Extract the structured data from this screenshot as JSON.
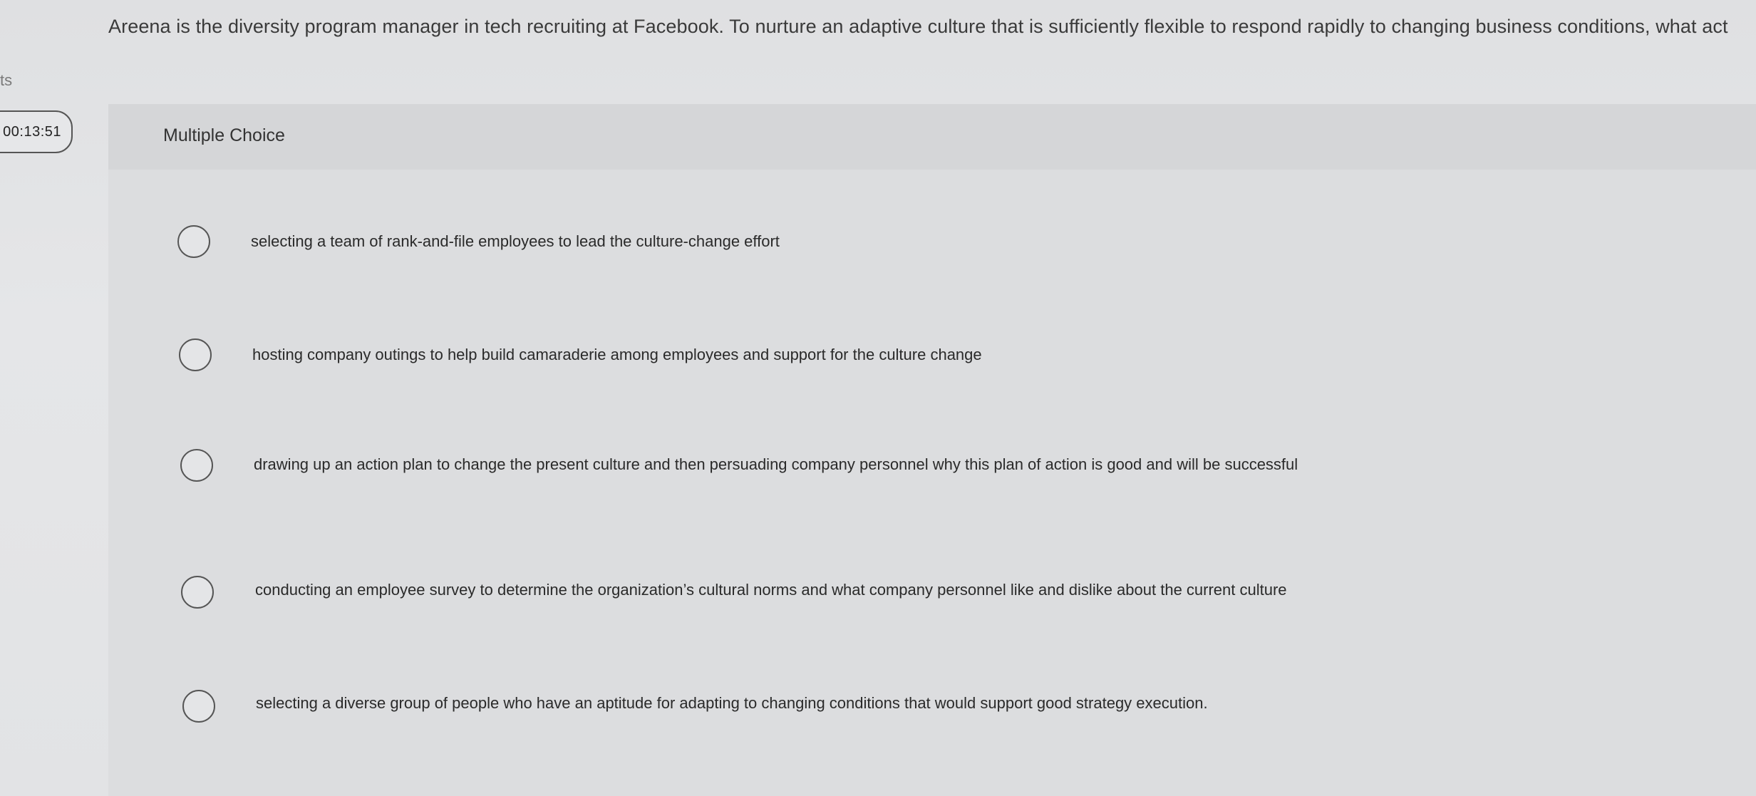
{
  "question": {
    "text": "Areena is the diversity program manager in tech recruiting at Facebook. To nurture an adaptive culture that is sufficiently flexible to respond rapidly to changing business conditions, what act"
  },
  "left_panel": {
    "fragment_text": "ts",
    "timer": "00:13:51"
  },
  "section": {
    "type_label": "Multiple Choice"
  },
  "choices": [
    {
      "label": "selecting a team of rank-and-file employees to lead the culture-change effort",
      "selected": false
    },
    {
      "label": "hosting company outings to help build camaraderie among employees and support for the culture change",
      "selected": false
    },
    {
      "label": "drawing up an action plan to change the present culture and then persuading company personnel why this plan of action is good and will be successful",
      "selected": false
    },
    {
      "label": "conducting an employee survey to determine the organization’s cultural norms and what company personnel like and dislike about the current culture",
      "selected": false
    },
    {
      "label": "selecting a diverse group of people who have an aptitude for adapting to changing conditions that would support good strategy execution.",
      "selected": false
    }
  ]
}
